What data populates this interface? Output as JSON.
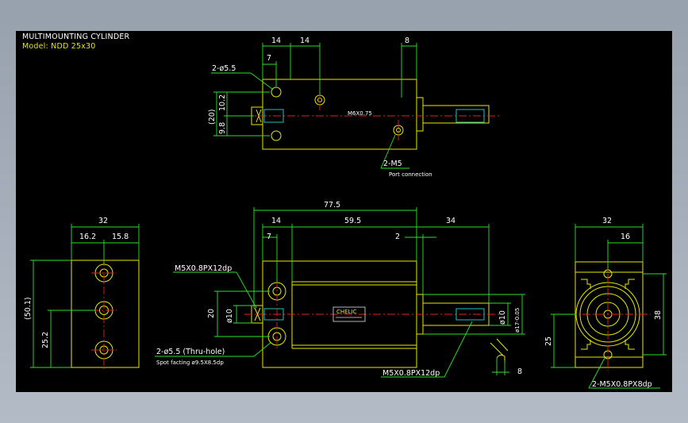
{
  "header": {
    "title": "MULTIMOUNTING CYLINDER",
    "model": "Model: NDD 25x30"
  },
  "top_view": {
    "dims": [
      "14",
      "14",
      "8",
      "7",
      "(20)",
      "10.2",
      "9.8"
    ],
    "hole_label": "2-ø5.5",
    "port_label": "2-M5",
    "port_note": "Port connection",
    "center_mark": "M6X0.75"
  },
  "left_view": {
    "dims": [
      "32",
      "16.2",
      "15.8",
      "(50.1)",
      "25.2"
    ]
  },
  "front_view": {
    "dims": [
      "77.5",
      "14",
      "59.5",
      "34",
      "7",
      "2",
      "20",
      "ø10",
      "ø10",
      "ø17-0.05",
      "8"
    ],
    "thread_label": "M5X0.8PX12dp",
    "hole_label": "2-ø5.5 (Thru-hole)",
    "spot_label": "Spot facting  ø9.5X8.5dp",
    "rod_thread_label": "M5X0.8PX12dp",
    "plate_text": "CHELIC"
  },
  "right_view": {
    "dims": [
      "32",
      "16",
      "38",
      "25"
    ],
    "thread_label": "2-M5X0.8PX8dp"
  },
  "colors": {
    "background": "#000000",
    "outline": "#e8e800",
    "dimension": "#27e527",
    "centerline": "#e02222",
    "hidden": "#22d8d8",
    "text": "#ffffff",
    "window": "#a7b0bc"
  }
}
